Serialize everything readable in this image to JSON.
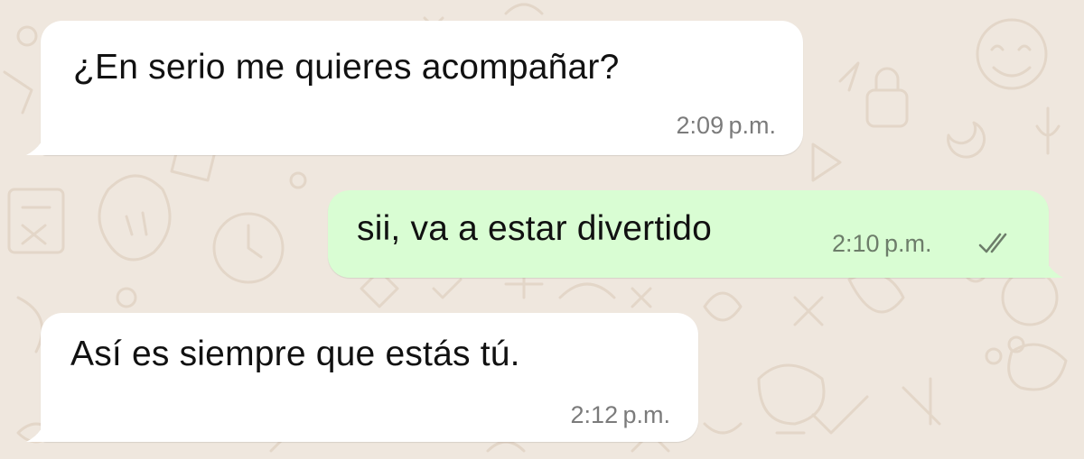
{
  "conversation": {
    "messages": [
      {
        "direction": "incoming",
        "text": "¿En serio me quieres acompañar?",
        "time": "2:09 p.m."
      },
      {
        "direction": "outgoing",
        "text": "sii, va a estar divertido",
        "time": "2:10 p.m.",
        "status": "read-receipt-double-check"
      },
      {
        "direction": "incoming",
        "text": "Así es siempre que estás tú.",
        "time": "2:12 p.m."
      }
    ]
  },
  "theme": {
    "wallpaper": "#efe7de",
    "wallpaper_doodle": "#e3d6c8",
    "incoming_bubble": "#ffffff",
    "outgoing_bubble": "#d9fdd3",
    "text": "#111111",
    "timestamp": "#7b7b7b",
    "check_icon": "#6d7d6a"
  }
}
